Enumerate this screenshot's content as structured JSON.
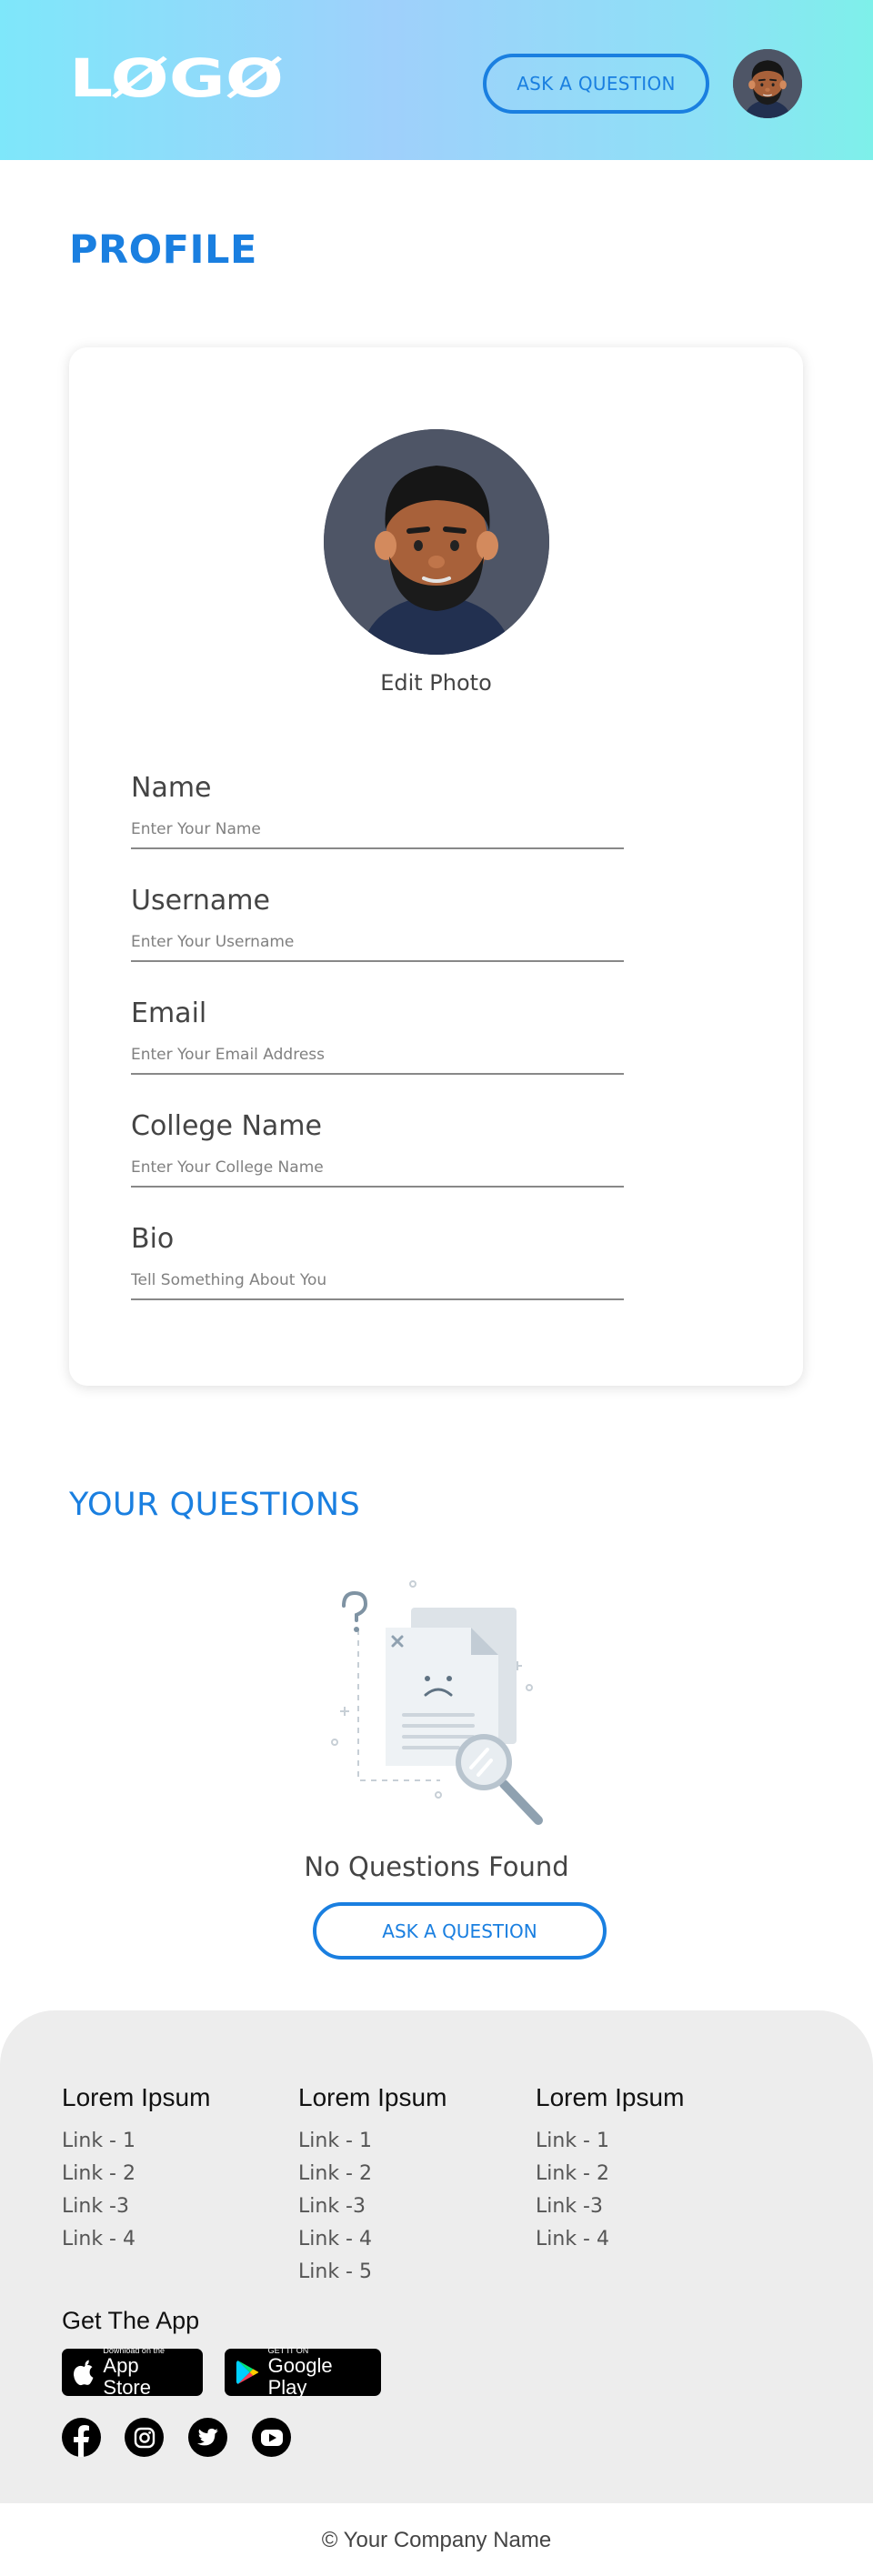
{
  "header": {
    "logo_text": "LØGØ",
    "ask_button": "ASK A QUESTION"
  },
  "profile": {
    "title": "PROFILE",
    "edit_photo": "Edit Photo",
    "fields": [
      {
        "label": "Name",
        "placeholder": "Enter Your Name"
      },
      {
        "label": "Username",
        "placeholder": "Enter Your Username"
      },
      {
        "label": "Email",
        "placeholder": "Enter Your Email Address"
      },
      {
        "label": "College Name",
        "placeholder": "Enter Your College Name"
      },
      {
        "label": "Bio",
        "placeholder": "Tell Something About You"
      }
    ]
  },
  "questions": {
    "title": "YOUR QUESTIONS",
    "empty_text": "No Questions Found",
    "ask_button": "ASK A QUESTION"
  },
  "footer": {
    "columns": [
      {
        "heading": "Lorem Ipsum",
        "links": [
          "Link - 1",
          "Link - 2",
          "Link -3",
          "Link - 4"
        ]
      },
      {
        "heading": "Lorem Ipsum",
        "links": [
          "Link - 1",
          "Link - 2",
          "Link -3",
          "Link - 4",
          "Link - 5"
        ]
      },
      {
        "heading": "Lorem Ipsum",
        "links": [
          "Link - 1",
          "Link - 2",
          "Link -3",
          "Link - 4"
        ]
      }
    ],
    "get_app": "Get The App",
    "app_store": {
      "small": "Download on the",
      "big": "App Store"
    },
    "google_play": {
      "small": "GET IT ON",
      "big": "Google Play"
    },
    "socials": [
      "facebook-icon",
      "instagram-icon",
      "twitter-icon",
      "youtube-icon"
    ],
    "copyright": "© Your Company Name"
  },
  "colors": {
    "accent": "#1a7fe0",
    "footer_bg": "#ededed"
  }
}
